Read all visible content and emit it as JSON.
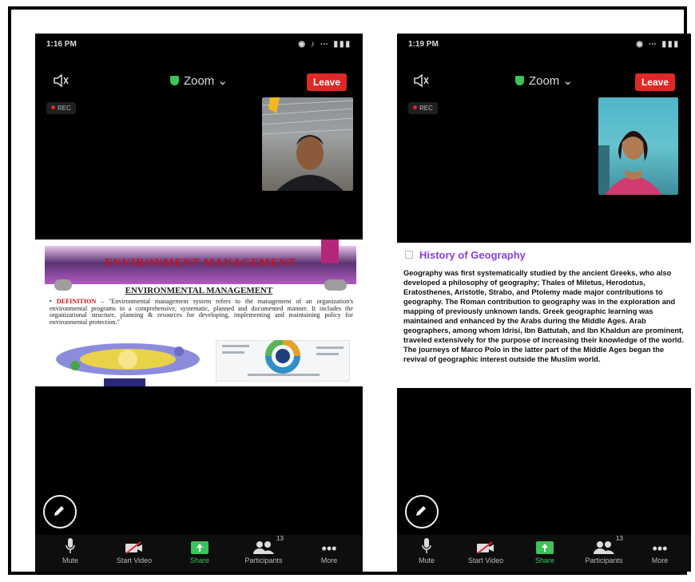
{
  "left_phone": {
    "time": "1:16 PM",
    "app_title": "Zoom",
    "leave_label": "Leave",
    "rec_label": "REC",
    "slide": {
      "banner_title": "ENVIRONMENT MANAGEMENT",
      "heading": "ENVIRONMENTAL MANAGEMENT",
      "definition_label": "DEFINITION",
      "definition_text": "– \"Environmental management system refers to the management of an organization's environmental programs in a comprehensive, systematic, planned and documented manner. It includes the organizational structure, planning & resources for developing, implementing and maintaining policy for environmental protection.\""
    },
    "toolbar": {
      "mute": "Mute",
      "start_video": "Start Video",
      "share": "Share",
      "participants": "Participants",
      "participants_count": "13",
      "more": "More"
    }
  },
  "right_phone": {
    "time": "1:19 PM",
    "app_title": "Zoom",
    "leave_label": "Leave",
    "rec_label": "REC",
    "slide": {
      "title": "History of Geography",
      "body": "Geography was first systematically studied by the ancient Greeks, who also developed a philosophy of geography; Thales of Miletus, Herodotus, Eratosthenes, Aristotle, Strabo, and Ptolemy made major contributions to geography. The Roman contribution to geography was in the exploration and mapping of previously unknown lands. Greek geographic learning was maintained and enhanced by the Arabs during the Middle Ages. Arab geographers, among whom Idrisi, Ibn Battutah, and Ibn Khaldun are prominent, traveled extensively for the purpose of increasing their knowledge of the world. The journeys of Marco Polo in the latter part of the Middle Ages began the revival of geographic interest outside the Muslim world."
    },
    "toolbar": {
      "mute": "Mute",
      "start_video": "Start Video",
      "share": "Share",
      "participants": "Participants",
      "participants_count": "13",
      "more": "More"
    }
  },
  "colors": {
    "leave": "#e02828",
    "share_green": "#3cc45a",
    "slide_title_purple": "#8a3ddb"
  }
}
